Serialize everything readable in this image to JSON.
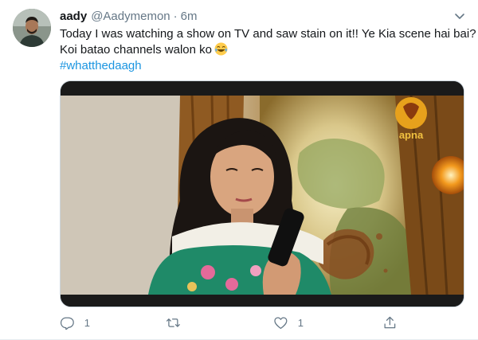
{
  "tweet": {
    "display_name": "aady",
    "handle": "@Aadymemon",
    "separator": "·",
    "time": "6m",
    "text_line1": "Today I was watching a show on TV and saw stain on it!! Ye Kia scene hai bai?",
    "text_line2": "Koi batao channels walon ko",
    "emoji": "face-with-tears-of-joy",
    "hashtag": "#whatthedaagh",
    "media": {
      "channel_logo_text": "apna"
    },
    "actions": {
      "reply_count": "1",
      "retweet_count": "",
      "like_count": "1"
    }
  },
  "colors": {
    "text": "#14171a",
    "secondary": "#657786",
    "link": "#1b95e0",
    "border": "#e6ecf0",
    "logo_orange": "#e7a11c"
  },
  "icons": [
    "avatar",
    "chevron-down-icon",
    "reply-icon",
    "retweet-icon",
    "like-icon",
    "share-icon"
  ]
}
